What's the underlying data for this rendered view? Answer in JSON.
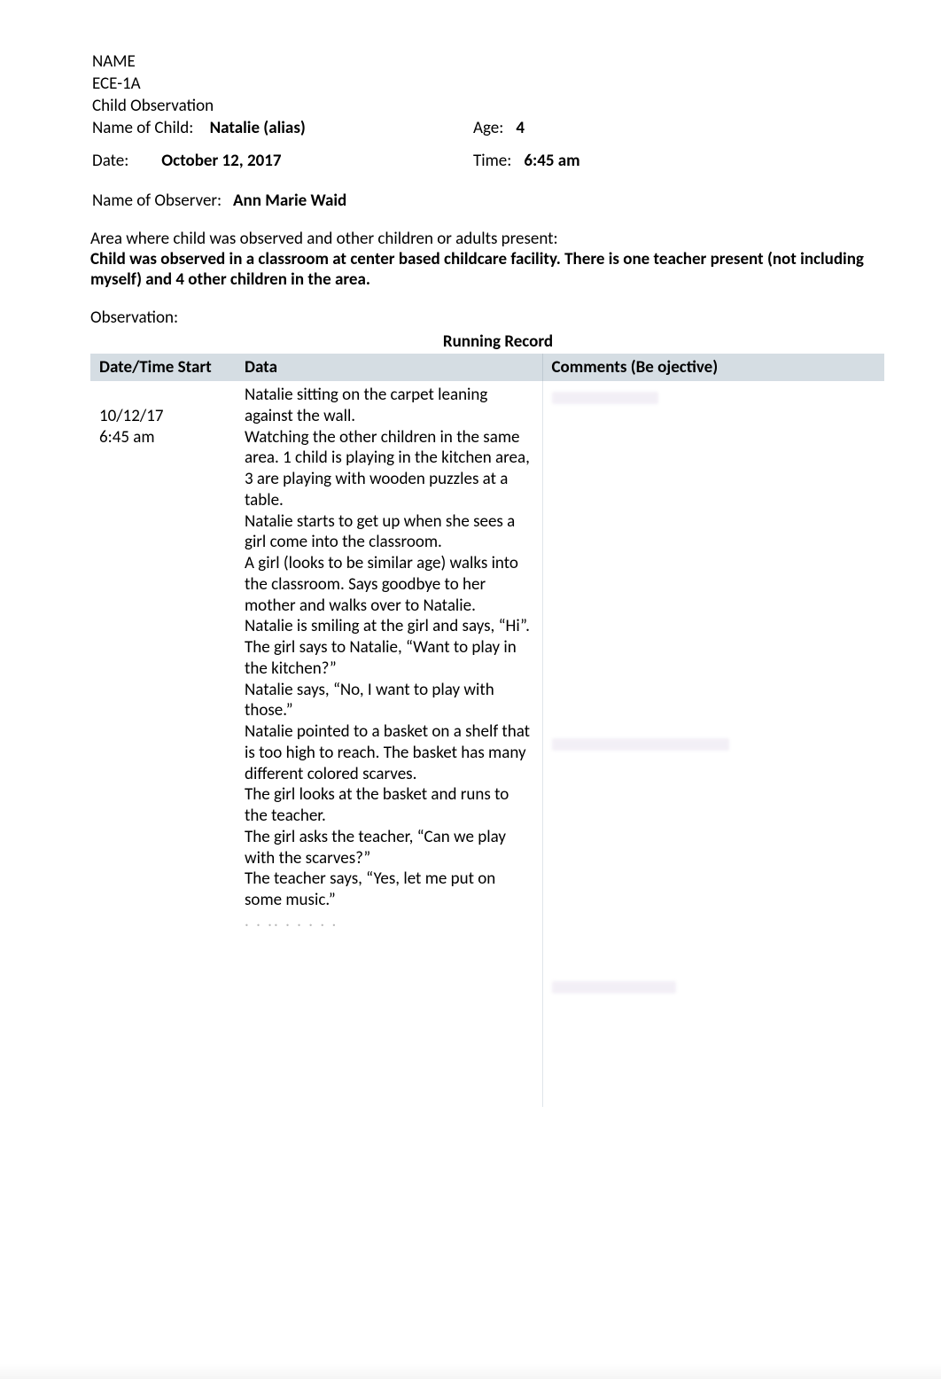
{
  "header": {
    "name_line": "NAME",
    "course": "ECE-1A",
    "doc_title": "Child Observation",
    "child_label": "Name of Child:",
    "child_value": "Natalie (alias)",
    "age_label": "Age:",
    "age_value": "4",
    "date_label": "Date:",
    "date_value": "October 12, 2017",
    "time_label": "Time:",
    "time_value": "6:45 am",
    "observer_label": "Name of Observer:",
    "observer_value": "Ann Marie Waid"
  },
  "area": {
    "prompt": "Area where child was observed and other children or adults present:",
    "text": "Child was observed in a classroom at center based childcare facility.  There is one teacher present (not including myself) and 4 other children in the area."
  },
  "observation_label": "Observation:",
  "table": {
    "title": "Running Record",
    "headers": {
      "dt": "Date/Time Start",
      "data": "Data",
      "comments": "Comments (Be ojective)"
    },
    "row": {
      "dt_line1": "10/12/17",
      "dt_line2": "6:45 am",
      "data_paragraphs": [
        "Natalie sitting on the carpet leaning against the wall.",
        "Watching the other children in the same area.  1 child is playing in the kitchen area, 3   are playing with wooden puzzles at a table.",
        "Natalie starts to get up when she sees a girl come into the classroom.",
        "A girl (looks to be similar age) walks into the classroom.  Says goodbye to her mother and walks over to Natalie.",
        "Natalie is smiling at the girl and says, “Hi”.",
        "The girl says to Natalie, “Want to play in the kitchen?”",
        "Natalie says, “No, I want to play with those.”",
        "Natalie pointed to a basket on a shelf that is too high to reach.  The basket has many different colored scarves.",
        "The girl looks at the basket and runs to the teacher.",
        "The girl asks the teacher, “Can we play with the scarves?”",
        "The teacher says, “Yes, let me put on some music.”"
      ]
    }
  }
}
